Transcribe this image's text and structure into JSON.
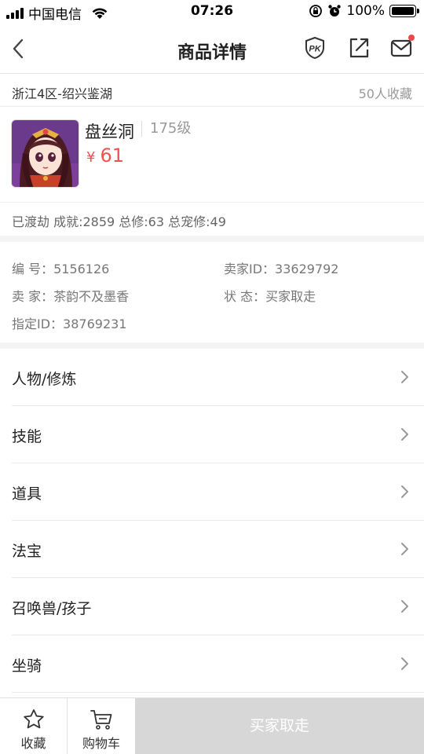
{
  "status_bar": {
    "carrier": "中国电信",
    "time": "07:26",
    "battery": "100%"
  },
  "nav": {
    "title": "商品详情",
    "icons": [
      "back-icon",
      "pk-icon",
      "share-icon",
      "mail-icon"
    ],
    "mail_has_notification": true
  },
  "server": {
    "name": "浙江4区-绍兴鉴湖",
    "favorites": "50人收藏"
  },
  "product": {
    "name": "盘丝洞",
    "level": "175级",
    "currency": "¥",
    "price": "61",
    "stats": "已渡劫 成就:2859 总修:63 总宠修:49"
  },
  "info": {
    "serial": "编 号：5156126",
    "seller_id": "卖家ID：33629792",
    "seller": "卖 家：茶韵不及墨香",
    "status": "状 态：买家取走",
    "assigned_id": "指定ID：38769231"
  },
  "menu": [
    {
      "label": "人物/修炼"
    },
    {
      "label": "技能"
    },
    {
      "label": "道具"
    },
    {
      "label": "法宝"
    },
    {
      "label": "召唤兽/孩子"
    },
    {
      "label": "坐骑"
    }
  ],
  "bottom": {
    "favorite_label": "收藏",
    "cart_label": "购物车",
    "action_label": "买家取走"
  },
  "colors": {
    "price": "#f0524f",
    "notification": "#f04848",
    "disabled_button": "#d7d7d7"
  }
}
